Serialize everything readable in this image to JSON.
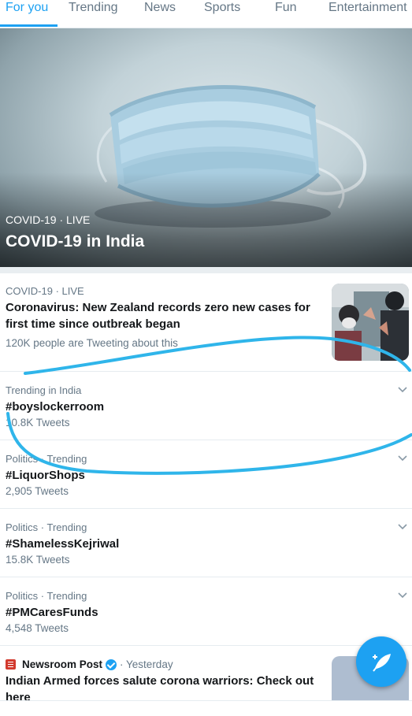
{
  "tabs": [
    {
      "label": "For you",
      "active": true
    },
    {
      "label": "Trending",
      "active": false
    },
    {
      "label": "News",
      "active": false
    },
    {
      "label": "Sports",
      "active": false
    },
    {
      "label": "Fun",
      "active": false
    },
    {
      "label": "Entertainment",
      "active": false
    }
  ],
  "hero": {
    "meta": "COVID-19 · LIVE",
    "title": "COVID-19 in India"
  },
  "feed": [
    {
      "meta": "COVID-19 · LIVE",
      "headline": "Coronavirus: New Zealand records zero new cases for first time since outbreak began",
      "count": "120K people are Tweeting about this"
    },
    {
      "meta": "Trending in India",
      "headline": "#boyslockerroom",
      "count": "10.8K Tweets"
    },
    {
      "meta": "Politics · Trending",
      "headline": "#LiquorShops",
      "count": "2,905 Tweets"
    },
    {
      "meta": "Politics · Trending",
      "headline": "#ShamelessKejriwal",
      "count": "15.8K Tweets"
    },
    {
      "meta": "Politics · Trending",
      "headline": "#PMCaresFunds",
      "count": "4,548 Tweets"
    }
  ],
  "news_item": {
    "source": "Newsroom Post",
    "time": "· Yesterday",
    "headline": "Indian Armed forces salute corona warriors: Check out here"
  },
  "icons": [
    "chevron-down-icon",
    "verified-badge-icon",
    "compose-tweet-icon",
    "newsroom-logo-icon"
  ],
  "colors": {
    "accent": "#1da1f2",
    "text": "#14171a",
    "secondary": "#657786",
    "annotation": "#2fb5ea"
  }
}
